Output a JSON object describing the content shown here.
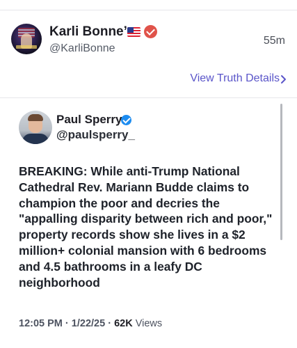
{
  "post": {
    "author_name": "Karli Bonne’",
    "author_handle": "@KarliBonne",
    "time_ago": "55m",
    "view_details_label": "View Truth Details"
  },
  "quoted": {
    "author_name": "Paul Sperry",
    "author_handle": "@paulsperry_",
    "body": "BREAKING: While anti-Trump National Cathedral Rev. Mariann Budde claims to champion the poor and decries the \"appalling disparity between rich and poor,\" property records show she lives in a $2 million+ colonial mansion with 6 bedrooms and 4.5 bathrooms in a leafy DC neighborhood",
    "time": "12:05 PM",
    "separator": "·",
    "date": "1/22/25",
    "views_count": "62K",
    "views_label": "Views"
  },
  "icons": {
    "flag": "us-flag-icon",
    "verified_primary": "verified-badge-icon",
    "verified_quoted": "verified-check-icon",
    "chevron": "chevron-right-icon"
  },
  "colors": {
    "link": "#5a55c9",
    "verified_primary": "#e0534a",
    "verified_quoted": "#1d8cf0"
  }
}
